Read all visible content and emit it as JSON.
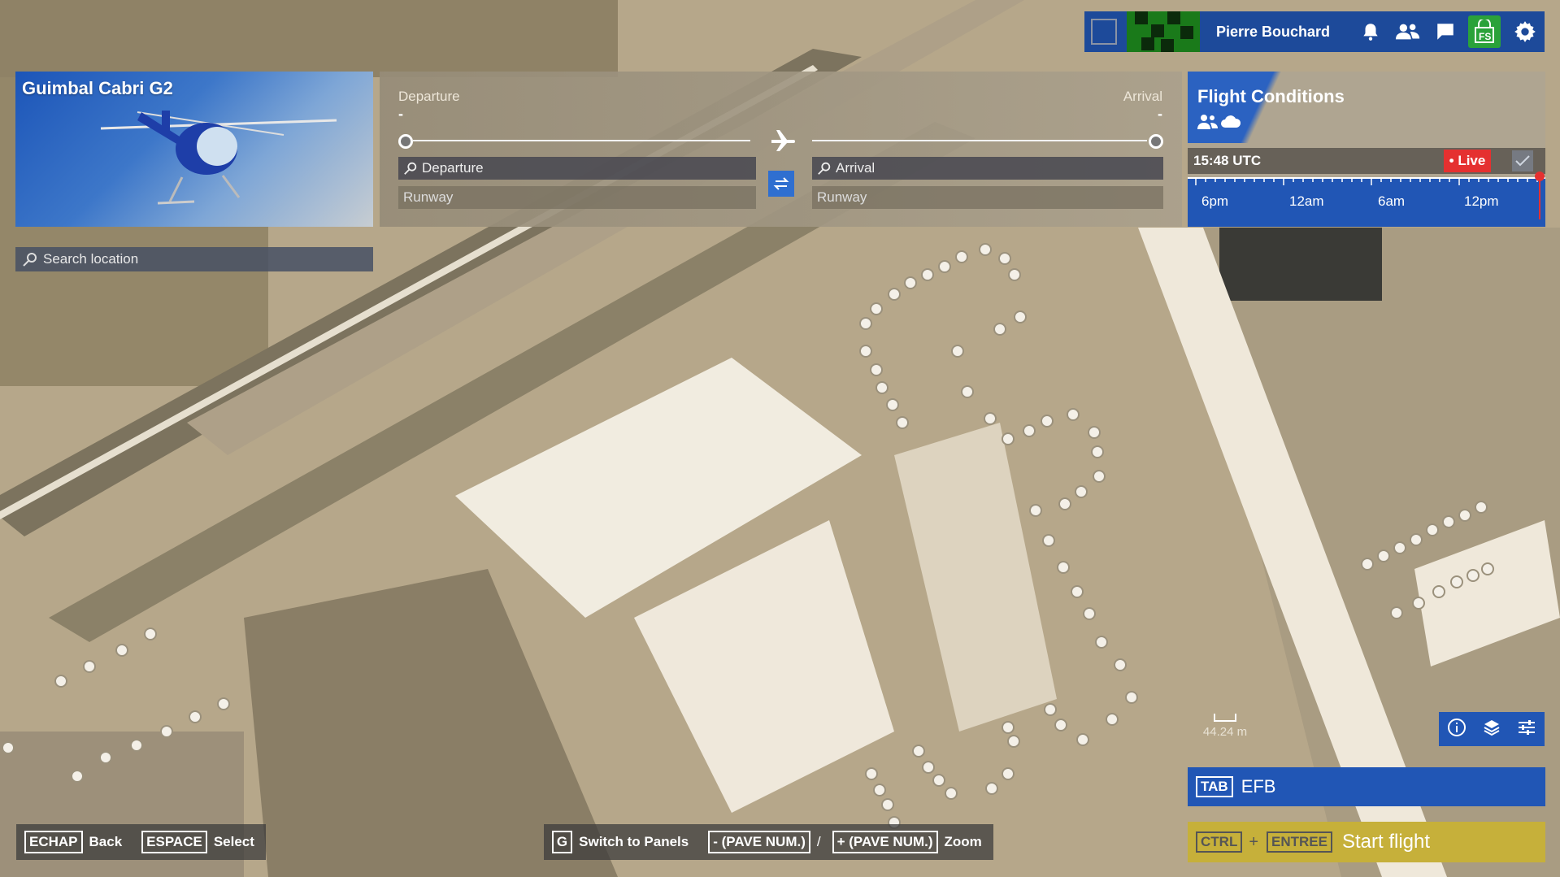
{
  "topbar": {
    "username": "Pierre Bouchard",
    "icons": [
      "bell-icon",
      "friends-icon",
      "chat-icon",
      "fs-marketplace-icon",
      "gear-icon"
    ]
  },
  "aircraft": {
    "name": "Guimbal Cabri G2"
  },
  "search_location": {
    "placeholder": "Search location"
  },
  "route": {
    "departure_label": "Departure",
    "arrival_label": "Arrival",
    "departure_code": "-",
    "arrival_code": "-",
    "departure_search_placeholder": "Departure",
    "arrival_search_placeholder": "Arrival",
    "departure_runway": "Runway",
    "arrival_runway": "Runway"
  },
  "flight_conditions": {
    "title": "Flight Conditions",
    "time": "15:48 UTC",
    "live_label": "• Live",
    "timeline_labels": [
      "6pm",
      "12am",
      "6am",
      "12pm"
    ]
  },
  "map": {
    "scale_text": "44.24 m"
  },
  "efb": {
    "key": "TAB",
    "label": "EFB"
  },
  "start_flight": {
    "key1": "CTRL",
    "plus": "+",
    "key2": "ENTREE",
    "label": "Start flight"
  },
  "hints": {
    "back_key": "ECHAP",
    "back_label": "Back",
    "select_key": "ESPACE",
    "select_label": "Select",
    "switch_key": "G",
    "switch_label": "Switch to Panels",
    "zoom_out_key": "- (PAVE NUM.)",
    "zoom_sep": "/",
    "zoom_in_key": "+ (PAVE NUM.)",
    "zoom_label": "Zoom"
  },
  "colors": {
    "accent_blue": "#2156b5",
    "live_red": "#e53030",
    "start_gold": "#c6b03a",
    "map_sepia": "#b8a98c"
  }
}
